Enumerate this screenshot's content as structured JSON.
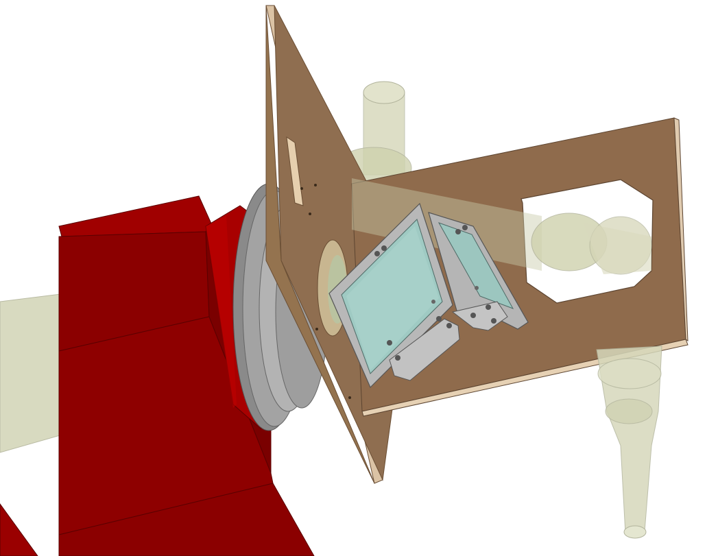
{
  "scene": {
    "colors": {
      "background": "#ffffff",
      "red_housing": "#8b0000",
      "red_housing_light": "#a30000",
      "red_housing_dark": "#6e0000",
      "flange_gray": "#a8a8a8",
      "flange_dark": "#7c7c7c",
      "board_brown": "#8b6a4c",
      "board_edge": "#d9c2a6",
      "beam_tube": "#d4d6b8",
      "mirror_frame": "#b4b4b4",
      "mirror_glass": "#9cc8c2"
    }
  }
}
